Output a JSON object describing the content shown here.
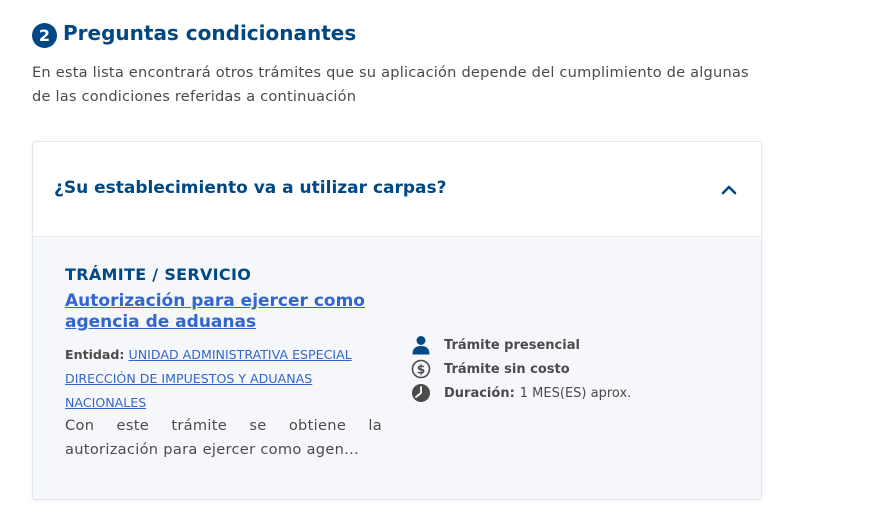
{
  "section": {
    "step": "2",
    "title": "Preguntas condicionantes",
    "intro": "En esta lista encontrará otros trámites que su aplicación depende del cumplimiento de algunas de las condiciones referidas a continuación"
  },
  "accordion": {
    "question": "¿Su establecimiento va a utilizar carpas?",
    "expanded": true,
    "procedure": {
      "kind": "TRÁMITE / SERVICIO",
      "title": "Autorización para ejercer como agencia de aduanas",
      "entity_label": "Entidad:",
      "entity_name": "UNIDAD ADMINISTRATIVA ESPECIAL DIRECCIÓN DE IMPUESTOS Y ADUANAS NACIONALES",
      "description_line1": "Con este trámite se obtiene la",
      "description_line2": "autorización para ejercer como agen...",
      "features": [
        {
          "icon": "person-icon",
          "label": "Trámite presencial",
          "value": ""
        },
        {
          "icon": "dollar-circle-icon",
          "label": "Trámite sin costo",
          "value": ""
        },
        {
          "icon": "clock-icon",
          "label": "Duración:",
          "value": "1 MES(ES) aprox."
        }
      ]
    }
  },
  "colors": {
    "primary": "#004884",
    "link": "#3366cc",
    "text": "#4b4b4b",
    "body_bg": "#f5f7fb",
    "icon": "#4b4b4b"
  }
}
